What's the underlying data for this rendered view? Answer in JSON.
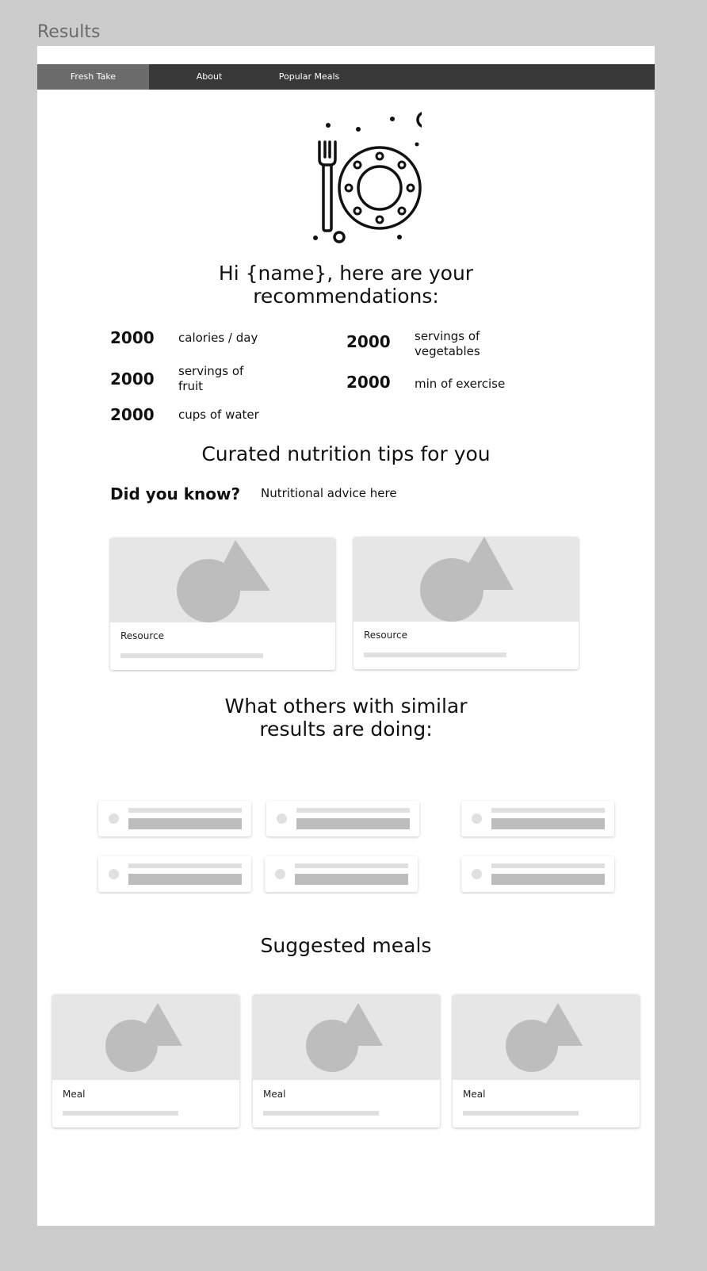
{
  "frame": {
    "title": "Results"
  },
  "nav": {
    "items": [
      {
        "label": "Fresh Take",
        "active": true
      },
      {
        "label": "About",
        "active": false
      },
      {
        "label": "Popular Meals",
        "active": false
      }
    ]
  },
  "hero": {
    "icon": "plate-fork-knife-icon"
  },
  "greeting": {
    "line1": "Hi {name}, here are your",
    "line2": "recommendations:"
  },
  "recommendations": [
    {
      "value": "2000",
      "label": "calories / day"
    },
    {
      "value": "2000",
      "label": "servings of vegetables"
    },
    {
      "value": "2000",
      "label": "servings of fruit"
    },
    {
      "value": "2000",
      "label": "min of exercise"
    },
    {
      "value": "2000",
      "label": "cups of water"
    }
  ],
  "tips": {
    "heading": "Curated nutrition tips for you",
    "did_you_know": "Did you know?",
    "advice": "Nutritional advice here",
    "resources": [
      {
        "label": "Resource"
      },
      {
        "label": "Resource"
      }
    ]
  },
  "peers": {
    "line1": "What others with similar",
    "line2": "results are doing:",
    "count": 6
  },
  "meals": {
    "heading": "Suggested meals",
    "items": [
      {
        "label": "Meal"
      },
      {
        "label": "Meal"
      },
      {
        "label": "Meal"
      }
    ]
  },
  "colors": {
    "nav_bg": "#383838",
    "nav_active": "#6b6b6b",
    "placeholder": "#bdbdbd",
    "image_bg": "#e6e6e6"
  }
}
